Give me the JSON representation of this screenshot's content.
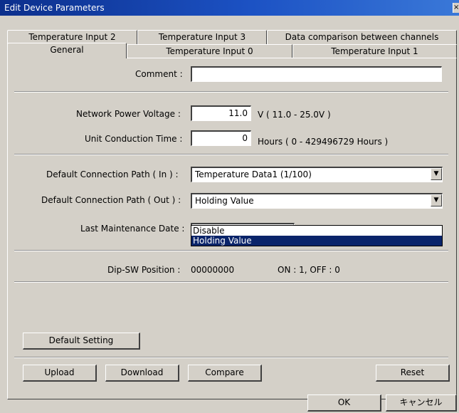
{
  "window": {
    "title": "Edit Device Parameters",
    "close_glyph": "×"
  },
  "tabs": {
    "row_back": [
      "Temperature Input 2",
      "Temperature Input 3",
      "Data comparison between channels"
    ],
    "row_front": [
      "General",
      "Temperature Input 0",
      "Temperature Input 1"
    ],
    "active": "General"
  },
  "general": {
    "comment_label": "Comment :",
    "comment_value": "",
    "voltage_label": "Network Power Voltage :",
    "voltage_value": "11.0",
    "voltage_unit": "V ( 11.0 - 25.0V )",
    "conduction_label": "Unit Conduction Time :",
    "conduction_value": "0",
    "conduction_unit": "Hours ( 0 - 429496729 Hours )",
    "path_in_label": "Default Connection Path ( In ) :",
    "path_in_value": "Temperature Data1 (1/100)",
    "path_out_label": "Default Connection Path ( Out ) :",
    "path_out_value": "Holding Value",
    "path_out_options": [
      "Disable",
      "Holding Value"
    ],
    "path_out_selected": "Holding Value",
    "maintenance_label": "Last Maintenance Date :",
    "dipsw_label": "Dip-SW Position :",
    "dipsw_value": "00000000",
    "dipsw_legend": "ON : 1, OFF : 0"
  },
  "buttons": {
    "default_setting": "Default Setting",
    "upload": "Upload",
    "download": "Download",
    "compare": "Compare",
    "reset": "Reset",
    "ok": "OK",
    "cancel": "キャンセル"
  },
  "icons": {
    "combo_arrow": "▼"
  }
}
